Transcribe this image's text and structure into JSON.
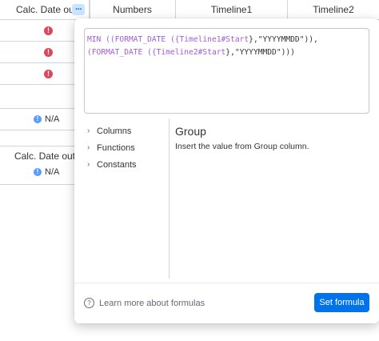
{
  "header": {
    "col1": "Calc. Date out",
    "more_icon": "more-dots-icon",
    "col2": "Numbers",
    "col3": "Timeline1",
    "col4": "Timeline2"
  },
  "rows": {
    "alert_icon": "alert-icon",
    "na_text": "N/A",
    "info_icon": "info-icon"
  },
  "subgroup": {
    "header": "Calc. Date out",
    "na_text": "N/A"
  },
  "formula": {
    "line1": [
      {
        "t": "MIN ((",
        "c": "fn"
      },
      {
        "t": "FORMAT_DATE",
        "c": "fn"
      },
      {
        "t": " ({",
        "c": "fn"
      },
      {
        "t": "Timeline1#Start",
        "c": "col"
      },
      {
        "t": "},\"YYYYMMDD\")),",
        "c": "str"
      }
    ],
    "line2": [
      {
        "t": "(",
        "c": "fn"
      },
      {
        "t": "FORMAT_DATE",
        "c": "fn"
      },
      {
        "t": " ({",
        "c": "fn"
      },
      {
        "t": "Timeline2#Start",
        "c": "col"
      },
      {
        "t": "},\"YYYYMMDD\")))",
        "c": "str"
      }
    ]
  },
  "menu": {
    "items": [
      "Columns",
      "Functions",
      "Constants"
    ]
  },
  "detail": {
    "title": "Group",
    "description": "Insert the value from Group column."
  },
  "footer": {
    "help_text": "Learn more about formulas",
    "set_button": "Set formula"
  },
  "colors": {
    "accent": "#0073ea",
    "alert": "#e2445c",
    "info": "#579bfc",
    "formula_function": "#a25ddc"
  }
}
